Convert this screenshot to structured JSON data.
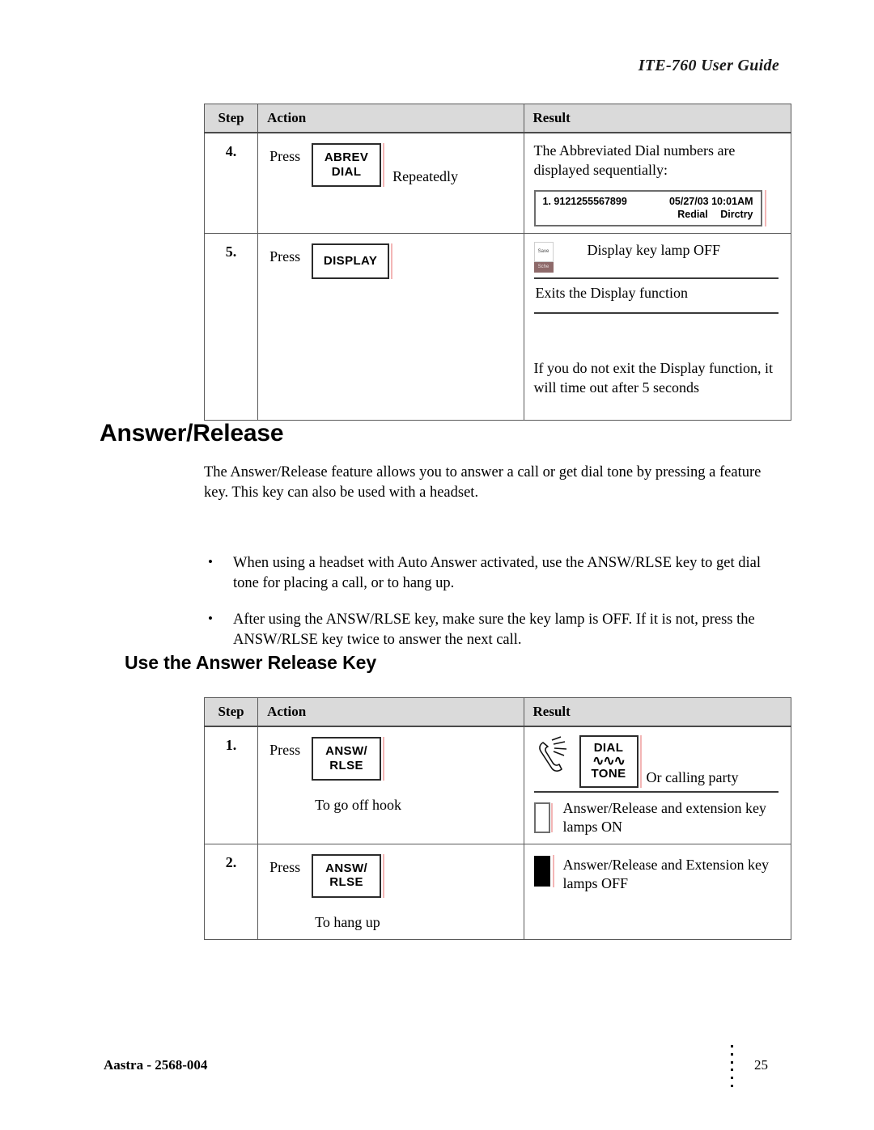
{
  "header": {
    "running_head": "ITE-760 User Guide"
  },
  "table_top": {
    "columns": [
      "Step",
      "Action",
      "Result"
    ],
    "rows": [
      {
        "step": "4.",
        "action": {
          "press_label": "Press",
          "key_lines": [
            "ABREV",
            "DIAL"
          ],
          "trailing_note": "Repeatedly"
        },
        "result": {
          "text": "The Abbreviated Dial numbers are displayed sequentially:",
          "lcd": {
            "entry": "1. 9121255567899",
            "datetime": "05/27/03 10:01AM",
            "softkey_left": "Redial",
            "softkey_right": "Dirctry"
          }
        }
      },
      {
        "step": "5.",
        "action": {
          "press_label": "Press",
          "key_lines": [
            "DISPLAY"
          ]
        },
        "result": {
          "lamp_icon_name": "display-key-lamp-icon",
          "lamp_icon_top_text": "Save",
          "lamp_icon_bottom_text": "Sche",
          "lamp_label": "Display key lamp OFF",
          "line_2": "Exits the Display function",
          "line_3": "If you do not exit the Display function, it will time out after 5 seconds"
        }
      }
    ]
  },
  "section": {
    "heading": "Answer/Release",
    "intro": "The Answer/Release feature allows you to answer a call or get dial tone by pressing a feature key.  This key can also be used with a headset.",
    "bullets": [
      "When using a headset with Auto Answer activated, use the ANSW/RLSE key to get dial tone for placing a call, or to hang up.",
      "After using the ANSW/RLSE key, make sure the key lamp is OFF.  If it is not, press the ANSW/RLSE key twice to answer the next call."
    ],
    "subheading": "Use the Answer Release Key"
  },
  "table_bottom": {
    "columns": [
      "Step",
      "Action",
      "Result"
    ],
    "rows": [
      {
        "step": "1.",
        "action": {
          "press_label": "Press",
          "key_lines": [
            "ANSW/",
            "RLSE"
          ],
          "sub_note": "To go off hook"
        },
        "result": {
          "handset_icon_name": "off-hook-handset-icon",
          "dialtone_key": {
            "line1": "DIAL",
            "tilde": "∿∿∿",
            "line2": "TONE"
          },
          "trailing_note": "Or calling party",
          "lamp_state": "on",
          "lamp_label": "Answer/Release and extension key lamps ON"
        }
      },
      {
        "step": "2.",
        "action": {
          "press_label": "Press",
          "key_lines": [
            "ANSW/",
            "RLSE"
          ],
          "sub_note": "To hang up"
        },
        "result": {
          "lamp_state": "off",
          "lamp_label": "Answer/Release and Extension key lamps OFF"
        }
      }
    ]
  },
  "footer": {
    "document_id": "Aastra - 2568-004",
    "page_number": "25"
  }
}
